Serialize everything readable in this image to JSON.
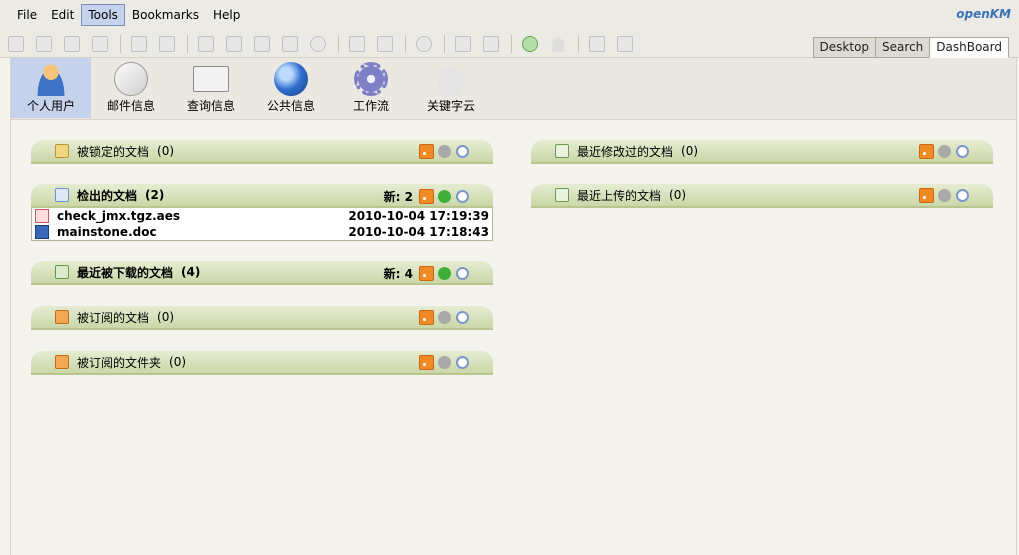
{
  "menubar": {
    "items": [
      "File",
      "Edit",
      "Tools",
      "Bookmarks",
      "Help"
    ],
    "active": "Tools"
  },
  "logo": {
    "main": "penKM",
    "prefix": "o"
  },
  "viewtabs": [
    "Desktop",
    "Search",
    "DashBoard"
  ],
  "dashboard": {
    "items": [
      {
        "label": "个人用户",
        "icon": "user-icon"
      },
      {
        "label": "邮件信息",
        "icon": "mail-icon"
      },
      {
        "label": "查询信息",
        "icon": "news-icon"
      },
      {
        "label": "公共信息",
        "icon": "globe-icon"
      },
      {
        "label": "工作流",
        "icon": "gear-icon"
      },
      {
        "label": "关键字云",
        "icon": "cloud-icon"
      }
    ]
  },
  "widgets": {
    "locked": {
      "title": "被锁定的文档",
      "count": "(0)"
    },
    "checkout": {
      "title": "检出的文档",
      "count": "(2)",
      "new_label": "新: 2",
      "rows": [
        {
          "name": "check_jmx.tgz.aes",
          "date": "2010-10-04 17:19:39"
        },
        {
          "name": "mainstone.doc",
          "date": "2010-10-04 17:18:43"
        }
      ]
    },
    "downloaded": {
      "title": "最近被下载的文档",
      "count": "(4)",
      "new_label": "新: 4"
    },
    "sub_docs": {
      "title": "被订阅的文档",
      "count": "(0)"
    },
    "sub_folders": {
      "title": "被订阅的文件夹",
      "count": "(0)"
    },
    "modified": {
      "title": "最近修改过的文档",
      "count": "(0)"
    },
    "uploaded": {
      "title": "最近上传的文档",
      "count": "(0)"
    }
  }
}
